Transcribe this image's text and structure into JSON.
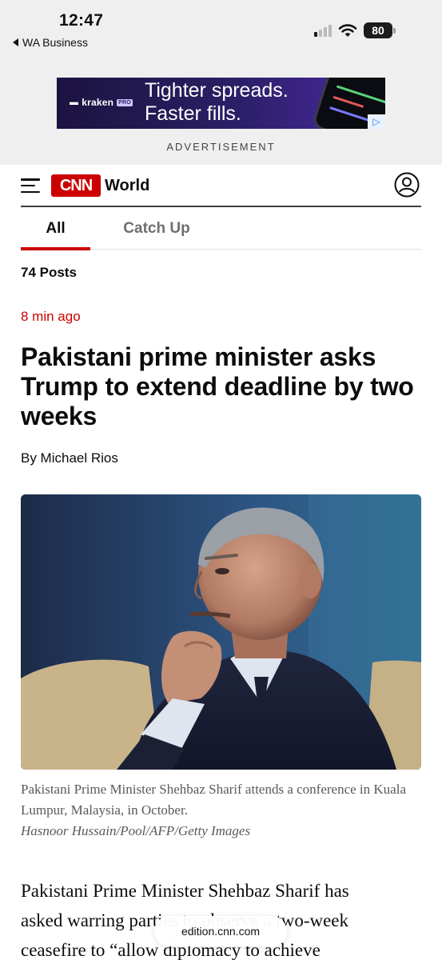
{
  "status_bar": {
    "time": "12:47",
    "back_app": "WA Business",
    "battery": "80"
  },
  "ad": {
    "brand": "kraken",
    "brand_badge": "PRO",
    "headline_line1": "Tighter spreads.",
    "headline_line2": "Faster fills.",
    "label": "ADVERTISEMENT"
  },
  "header": {
    "logo": "CNN",
    "section": "World"
  },
  "tabs": [
    {
      "label": "All",
      "active": true
    },
    {
      "label": "Catch Up",
      "active": false
    }
  ],
  "feed": {
    "post_count": "74 Posts",
    "post": {
      "time_ago": "8 min ago",
      "headline": "Pakistani prime minister asks Trump to extend deadline by two weeks",
      "byline": "By Michael Rios",
      "image_caption": "Pakistani Prime Minister Shehbaz Sharif attends a conference in Kuala Lumpur, Malaysia, in October.",
      "image_credit": "Hasnoor Hussain/Pool/AFP/Getty Images",
      "body_line1": "Pakistani Prime Minister Shehbaz Sharif has",
      "body_line2": "asked warring parties to observe a two-week",
      "body_line3": "ceasefire to “allow diplomacy to achieve"
    }
  },
  "browser": {
    "url": "edition.cnn.com"
  },
  "colors": {
    "cnn_red": "#cc0000",
    "caption_gray": "#595959",
    "tab_inactive": "#6e6e6e"
  },
  "icons": [
    "back-arrow-icon",
    "signal-icon",
    "wifi-icon",
    "battery-icon",
    "menu-icon",
    "account-icon",
    "ad-choices-icon"
  ]
}
